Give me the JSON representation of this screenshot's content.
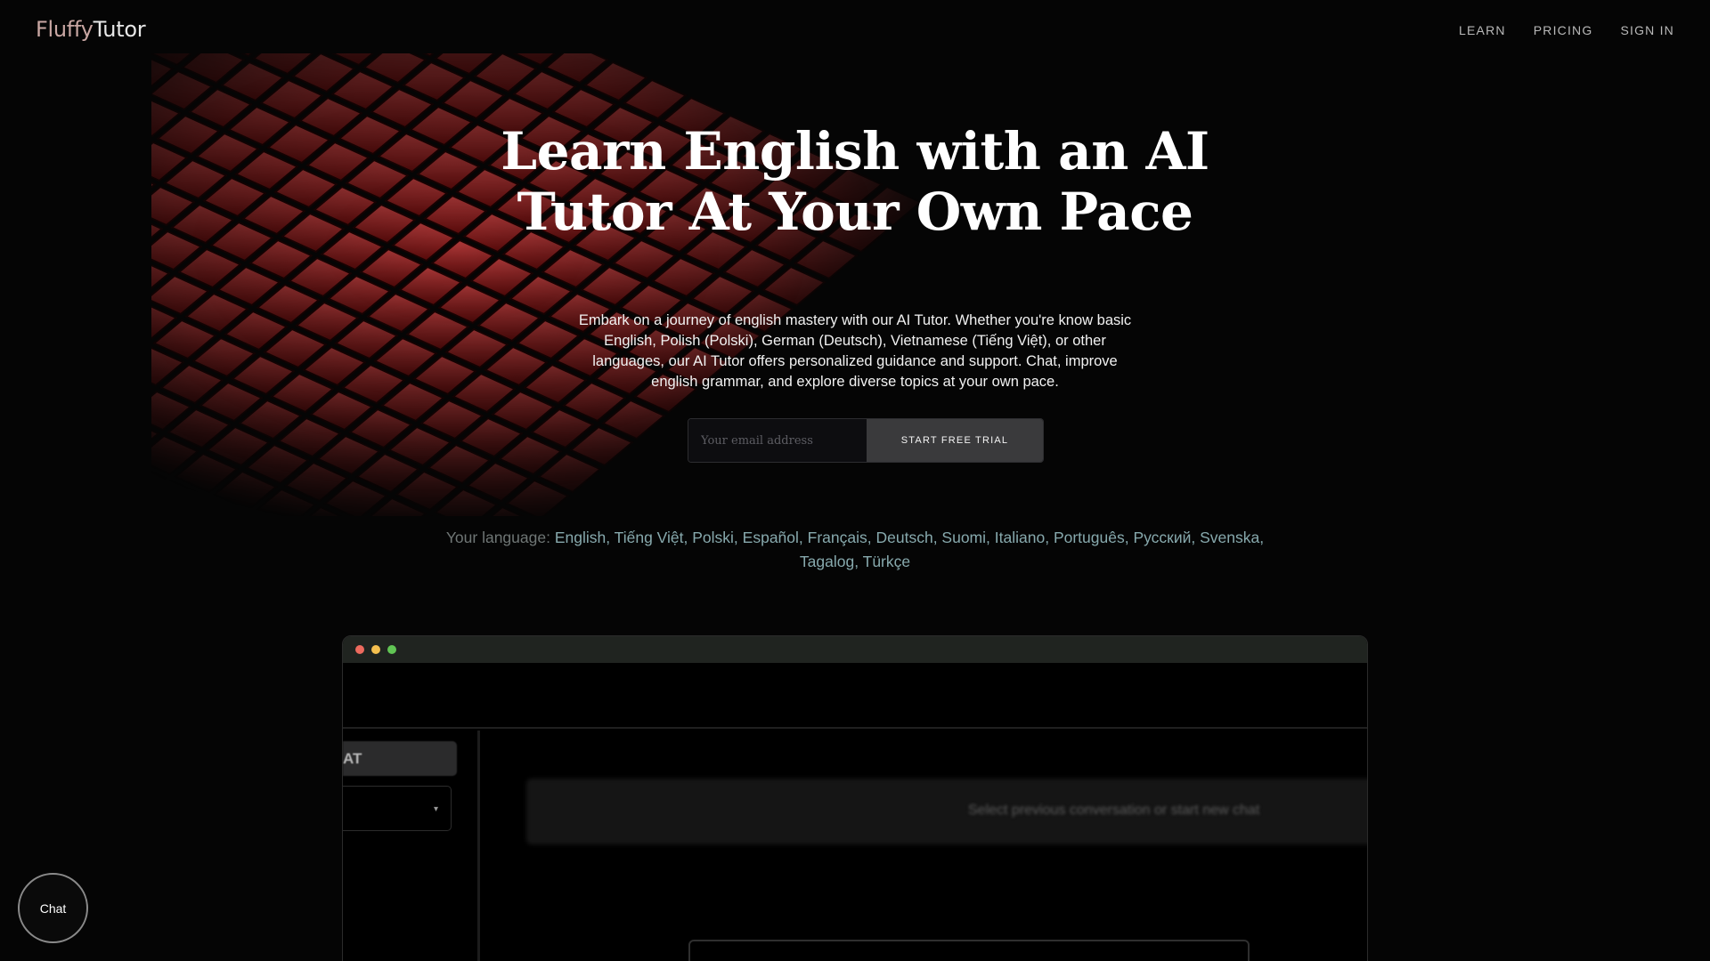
{
  "brand": {
    "part1": "Fluffy",
    "part2": "Tutor"
  },
  "nav": {
    "learn": "LEARN",
    "pricing": "PRICING",
    "signin": "SIGN IN"
  },
  "hero": {
    "title": "Learn English with an AI Tutor At Your Own Pace",
    "description": "Embark on a journey of english mastery with our AI Tutor. Whether you're know basic English, Polish (Polski), German (Deutsch), Vietnamese (Tiếng Việt), or other languages, our AI Tutor offers personalized guidance and support. Chat, improve english grammar, and explore diverse topics at your own pace."
  },
  "signup": {
    "placeholder": "Your email address",
    "button": "START FREE TRIAL"
  },
  "languages": {
    "label": "Your language:",
    "items": [
      "English",
      "Tiếng Việt",
      "Polski",
      "Español",
      "Français",
      "Deutsch",
      "Suomi",
      "Italiano",
      "Português",
      "Русский",
      "Svenska",
      "Tagalog",
      "Türkçe"
    ]
  },
  "app_preview": {
    "new_chat_label": "AT",
    "empty_message": "Select previous conversation or start new chat",
    "caret": "▾"
  },
  "chat_widget": {
    "label": "Chat"
  },
  "colors": {
    "accent_grid": "#8a1a1a",
    "background": "#050505",
    "language_link": "#87a9ad"
  }
}
